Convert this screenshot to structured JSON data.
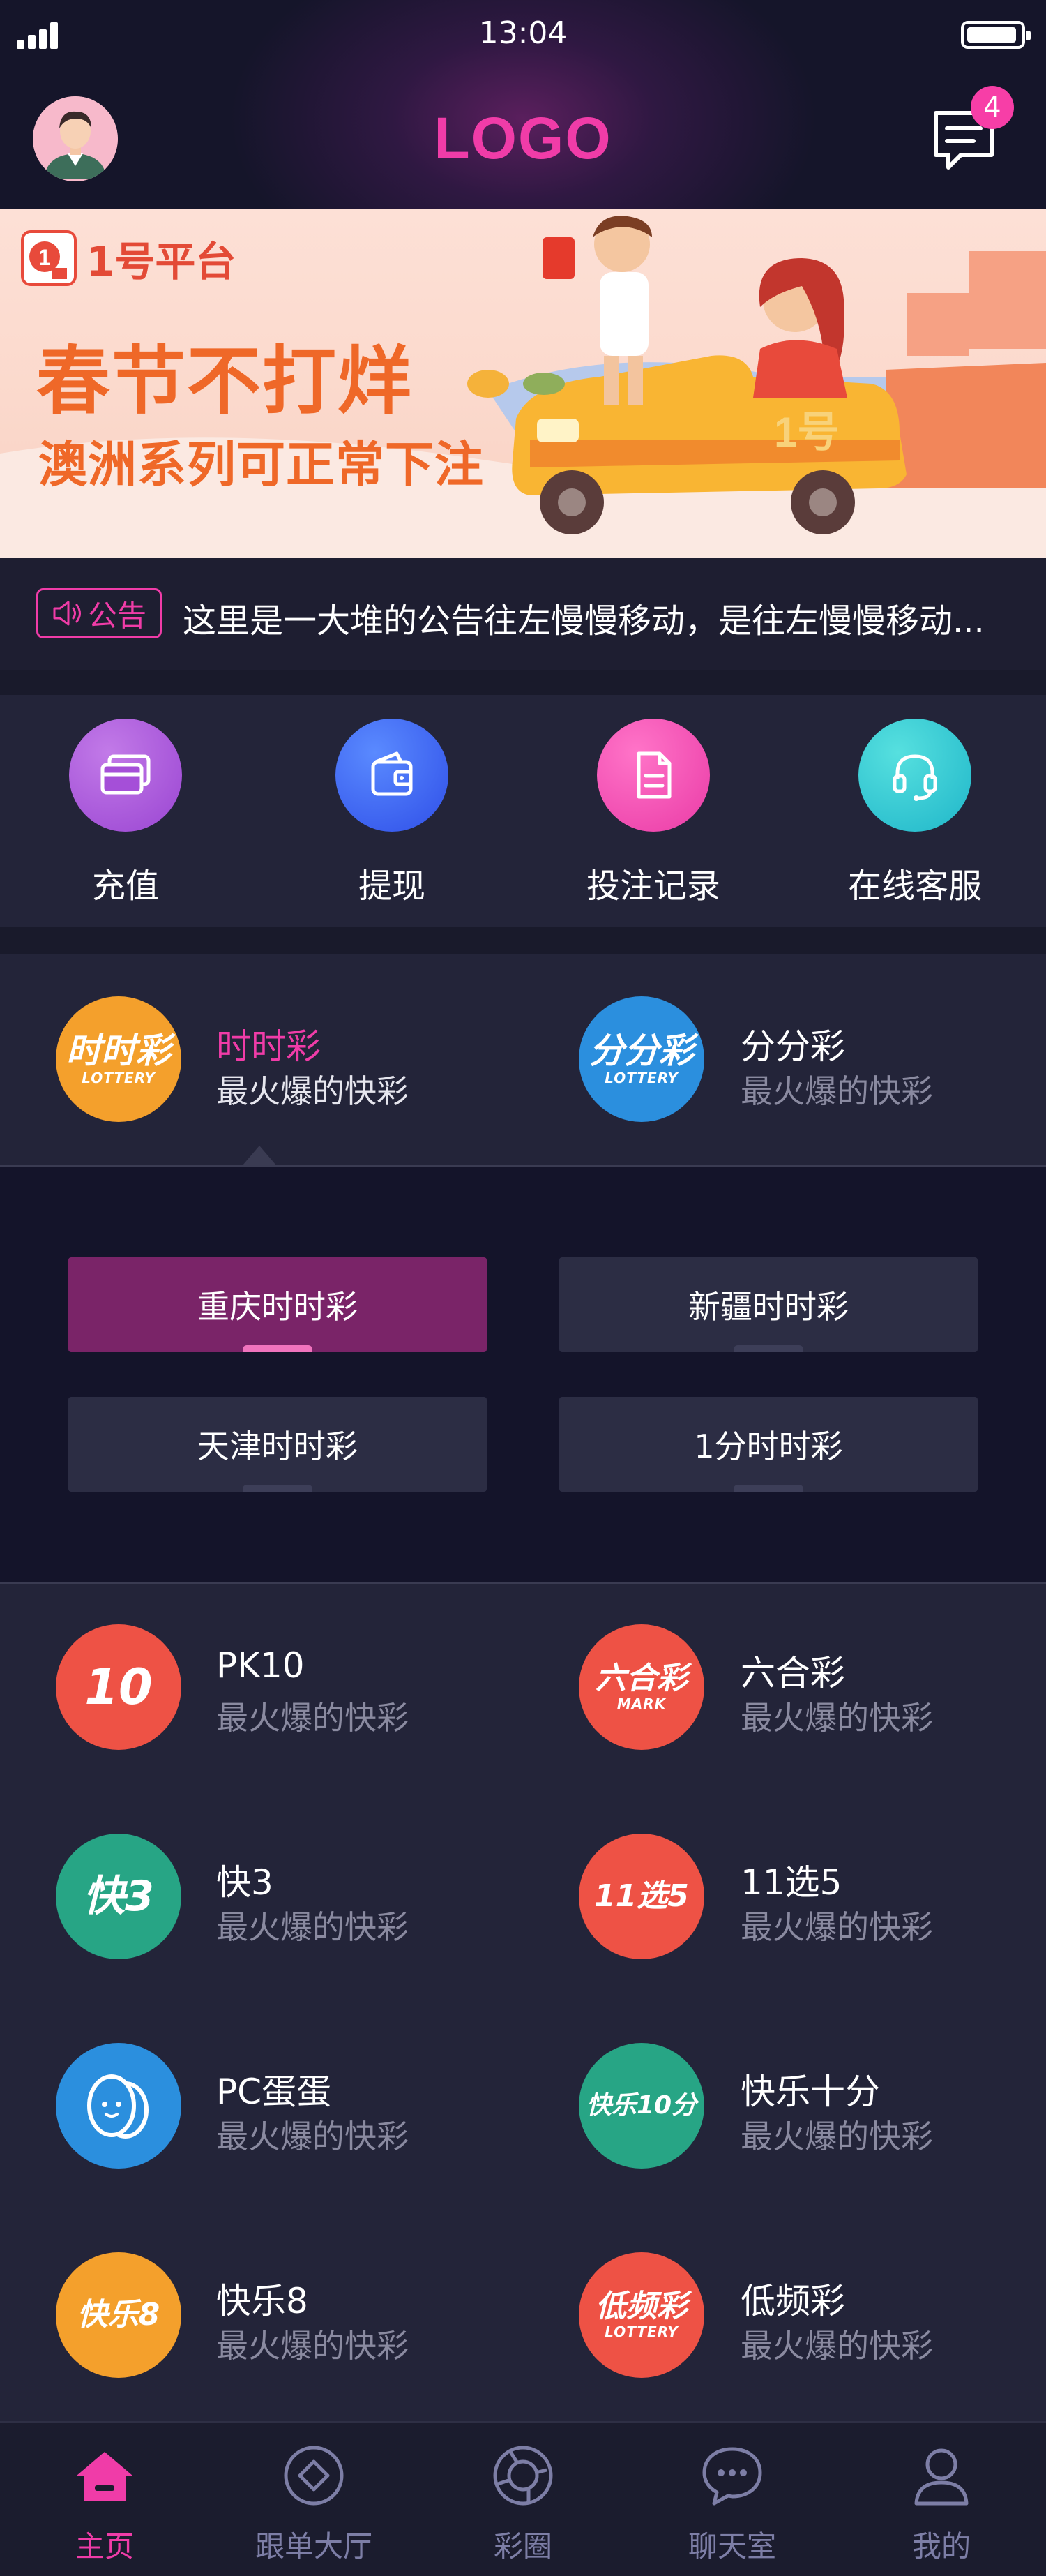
{
  "status": {
    "time": "13:04"
  },
  "header": {
    "logo": "LOGO",
    "message_count": "4"
  },
  "banner": {
    "brand": "1号平台",
    "title": "春节不打烊",
    "subtitle": "澳洲系列可正常下注",
    "car_label": "1号"
  },
  "notice": {
    "tag": "公告",
    "text": "这里是一大堆的公告往左慢慢移动，是往左慢慢移动..."
  },
  "actions": [
    {
      "label": "充值",
      "icon": "card-icon",
      "color": "#a14fd6"
    },
    {
      "label": "提现",
      "icon": "wallet-icon",
      "color": "#3a63f2"
    },
    {
      "label": "投注记录",
      "icon": "document-icon",
      "color": "#f04fb1"
    },
    {
      "label": "在线客服",
      "icon": "headset-icon",
      "color": "#2fc4cf"
    }
  ],
  "lottery_featured": [
    {
      "name": "时时彩",
      "desc": "最火爆的快彩",
      "icon_text": "时时彩",
      "icon_sub": "LOTTERY",
      "color": "#f4a02c",
      "active": true
    },
    {
      "name": "分分彩",
      "desc": "最火爆的快彩",
      "icon_text": "分分彩",
      "icon_sub": "LOTTERY",
      "color": "#2b8fde",
      "active": false
    }
  ],
  "sub_games": [
    {
      "label": "重庆时时彩",
      "active": true
    },
    {
      "label": "新疆时时彩",
      "active": false
    },
    {
      "label": "天津时时彩",
      "active": false
    },
    {
      "label": "1分时时彩",
      "active": false
    }
  ],
  "lottery_list": [
    {
      "name": "PK10",
      "desc": "最火爆的快彩",
      "icon_text": "10",
      "icon_sub": "",
      "color": "#ee5245"
    },
    {
      "name": "六合彩",
      "desc": "最火爆的快彩",
      "icon_text": "六合彩",
      "icon_sub": "MARK",
      "color": "#ee5245"
    },
    {
      "name": "快3",
      "desc": "最火爆的快彩",
      "icon_text": "快3",
      "icon_sub": "",
      "color": "#27a585"
    },
    {
      "name": "11选5",
      "desc": "最火爆的快彩",
      "icon_text": "11选5",
      "icon_sub": "",
      "color": "#ee5245"
    },
    {
      "name": "PC蛋蛋",
      "desc": "最火爆的快彩",
      "icon_text": "",
      "icon_sub": "",
      "color": "#2b8fde"
    },
    {
      "name": "快乐十分",
      "desc": "最火爆的快彩",
      "icon_text": "快乐10分",
      "icon_sub": "",
      "color": "#27a585"
    },
    {
      "name": "快乐8",
      "desc": "最火爆的快彩",
      "icon_text": "快乐8",
      "icon_sub": "",
      "color": "#f4a02c"
    },
    {
      "name": "低频彩",
      "desc": "最火爆的快彩",
      "icon_text": "低频彩",
      "icon_sub": "LOTTERY",
      "color": "#ee5245"
    }
  ],
  "nav": [
    {
      "label": "主页",
      "icon": "home-icon",
      "active": true
    },
    {
      "label": "跟单大厅",
      "icon": "diamond-icon",
      "active": false
    },
    {
      "label": "彩圈",
      "icon": "aperture-icon",
      "active": false
    },
    {
      "label": "聊天室",
      "icon": "chat-icon",
      "active": false
    },
    {
      "label": "我的",
      "icon": "person-icon",
      "active": false
    }
  ]
}
